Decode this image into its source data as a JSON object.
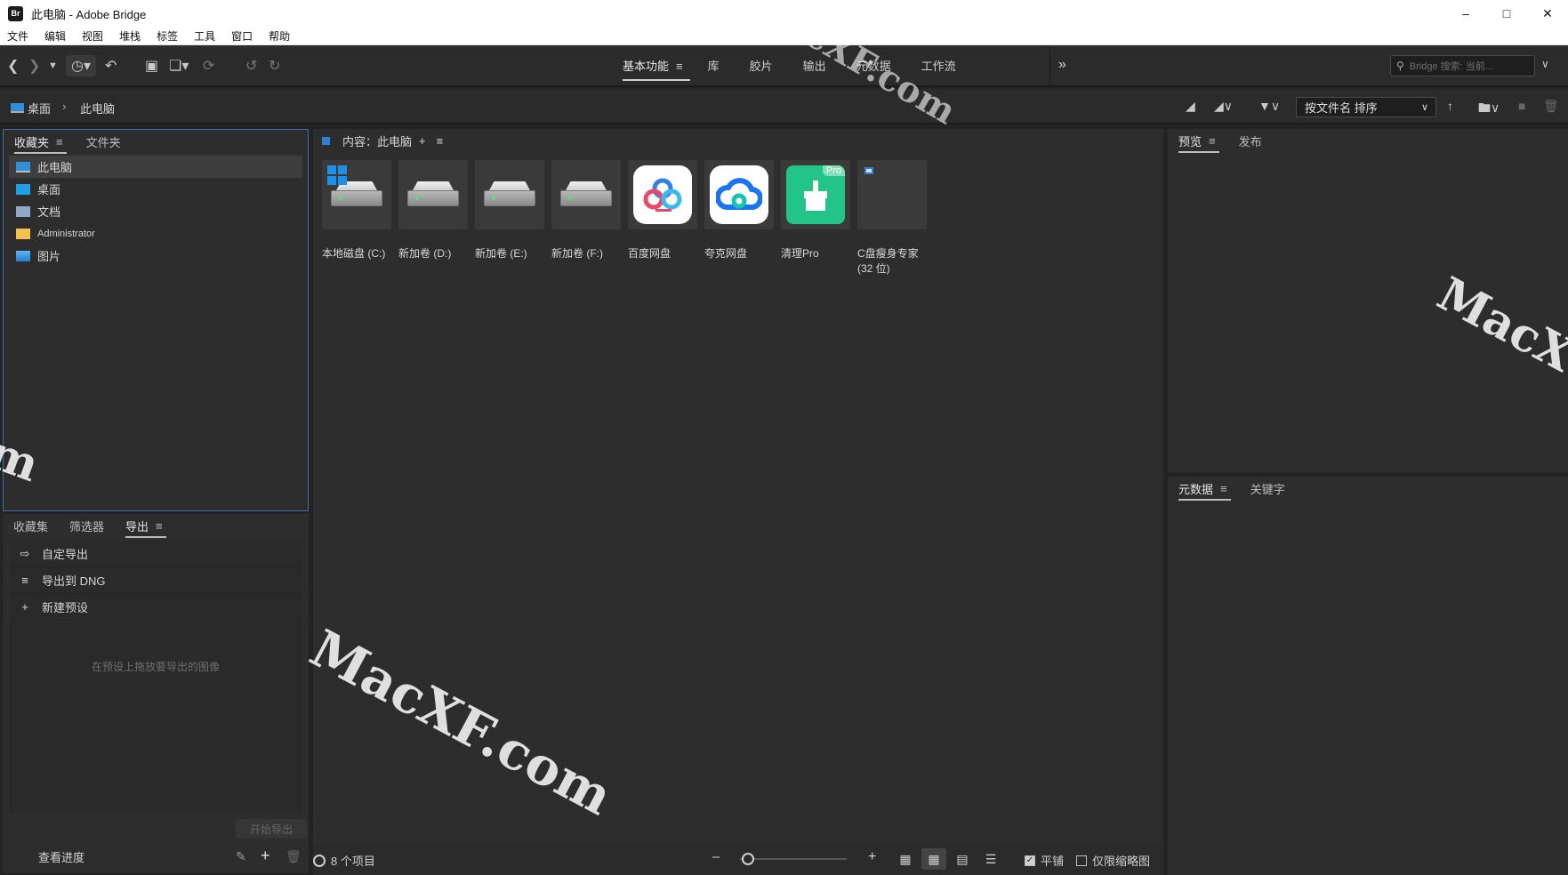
{
  "window": {
    "app_icon": "Br",
    "title": "此电脑 - Adobe Bridge"
  },
  "menu": [
    "文件",
    "编辑",
    "视图",
    "堆栈",
    "标签",
    "工具",
    "窗口",
    "帮助"
  ],
  "workspace_tabs": [
    {
      "label": "基本功能",
      "active": true
    },
    {
      "label": "库"
    },
    {
      "label": "胶片"
    },
    {
      "label": "输出"
    },
    {
      "label": "元数据"
    },
    {
      "label": "工作流"
    }
  ],
  "search": {
    "placeholder": "Bridge 搜索: 当前..."
  },
  "breadcrumb": {
    "items": [
      "桌面",
      "此电脑"
    ]
  },
  "sort": {
    "label": "按文件名 排序"
  },
  "favorites_panel": {
    "tabs": [
      "收藏夹",
      "文件夹"
    ],
    "items": [
      {
        "label": "此电脑",
        "icon": "computer-icon",
        "selected": true
      },
      {
        "label": "桌面",
        "icon": "desktop-icon"
      },
      {
        "label": "文档",
        "icon": "documents-icon"
      },
      {
        "label": "Administrator",
        "icon": "folder-icon"
      },
      {
        "label": "图片",
        "icon": "pictures-icon"
      }
    ]
  },
  "export_panel": {
    "tabs": [
      "收藏集",
      "筛选器",
      "导出"
    ],
    "items": [
      {
        "label": "自定导出",
        "icon": "export-icon"
      },
      {
        "label": "导出到 DNG",
        "icon": "list-icon"
      },
      {
        "label": "新建预设",
        "icon": "plus-icon"
      }
    ],
    "hint": "在预设上拖放要导出的图像",
    "start_button": "开始导出",
    "progress_link": "查看进度"
  },
  "content_panel": {
    "header": "内容：此电脑",
    "items": [
      {
        "label": "本地磁盘 (C:)",
        "kind": "drive-system"
      },
      {
        "label": "新加卷 (D:)",
        "kind": "drive"
      },
      {
        "label": "新加卷 (E:)",
        "kind": "drive"
      },
      {
        "label": "新加卷 (F:)",
        "kind": "drive"
      },
      {
        "label": "百度网盘",
        "kind": "baidu"
      },
      {
        "label": "夸克网盘",
        "kind": "quark"
      },
      {
        "label": "清理Pro",
        "kind": "cleanpro"
      },
      {
        "label": "C盘瘦身专家 (32 位)",
        "kind": "generic"
      }
    ],
    "app_badge": "Pro"
  },
  "status_bar": {
    "count": "8 个项目",
    "tile_label": "平铺",
    "thumb_only_label": "仅限缩略图",
    "tile_checked": true,
    "thumb_only_checked": false
  },
  "preview_panel": {
    "tabs": [
      "预览",
      "发布"
    ]
  },
  "metadata_panel": {
    "tabs": [
      "元数据",
      "关键字"
    ]
  },
  "watermarks": [
    "MacXF.com",
    "MacXF.com",
    "MacX",
    "m"
  ],
  "colors": {
    "accent_blue": "#2f7fd8",
    "panel": "#2d2d2d",
    "background": "#232323"
  }
}
